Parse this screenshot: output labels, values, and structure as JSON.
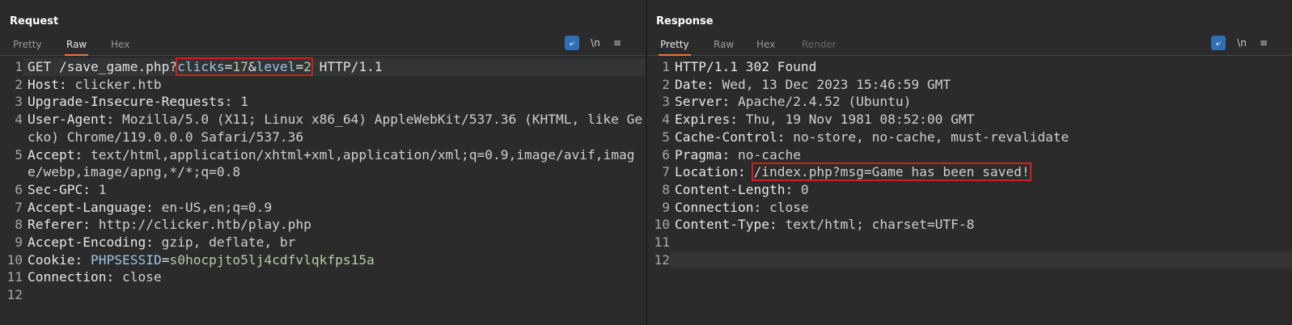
{
  "request": {
    "title": "Request",
    "tabs": [
      {
        "label": "Pretty",
        "active": false
      },
      {
        "label": "Raw",
        "active": true
      },
      {
        "label": "Hex",
        "active": false
      }
    ],
    "newline_toggle": "\\n",
    "menu_icon": "hamburger-icon",
    "lines": {
      "l1_method": "GET /save_game.php?",
      "l1_p1": "clicks",
      "l1_eq1": "=",
      "l1_v1": "17",
      "l1_amp": "&",
      "l1_p2": "level",
      "l1_eq2": "=",
      "l1_v2": "2",
      "l1_proto": " HTTP/1.1",
      "l2_name": "Host:",
      "l2_val": " clicker.htb",
      "l3_name": "Upgrade-Insecure-Requests:",
      "l3_val": " 1",
      "l4_name": "User-Agent:",
      "l4_val": " Mozilla/5.0 (X11; Linux x86_64) AppleWebKit/537.36 (KHTML, like Gecko) Chrome/119.0.0.0 Safari/537.36",
      "l5_name": "Accept:",
      "l5_val": " text/html,application/xhtml+xml,application/xml;q=0.9,image/avif,image/webp,image/apng,*/*;q=0.8",
      "l6_name": "Sec-GPC:",
      "l6_val": " 1",
      "l7_name": "Accept-Language:",
      "l7_val": " en-US,en;q=0.9",
      "l8_name": "Referer:",
      "l8_val": " http://clicker.htb/play.php",
      "l9_name": "Accept-Encoding:",
      "l9_val": " gzip, deflate, br",
      "l10_name": "Cookie:",
      "l10_cname": " PHPSESSID",
      "l10_eq": "=",
      "l10_cval": "s0hocpjto5lj4cdfvlqkfps15a",
      "l11_name": "Connection:",
      "l11_val": " close"
    }
  },
  "response": {
    "title": "Response",
    "tabs": [
      {
        "label": "Pretty",
        "active": true
      },
      {
        "label": "Raw",
        "active": false
      },
      {
        "label": "Hex",
        "active": false
      },
      {
        "label": "Render",
        "active": false
      }
    ],
    "newline_toggle": "\\n",
    "lines": {
      "l1": "HTTP/1.1 302 Found",
      "l2_name": "Date:",
      "l2_val": " Wed, 13 Dec 2023 15:46:59 GMT",
      "l3_name": "Server:",
      "l3_val": " Apache/2.4.52 (Ubuntu)",
      "l4_name": "Expires:",
      "l4_val": " Thu, 19 Nov 1981 08:52:00 GMT",
      "l5_name": "Cache-Control:",
      "l5_val": " no-store, no-cache, must-revalidate",
      "l6_name": "Pragma:",
      "l6_val": " no-cache",
      "l7_name": "Location:",
      "l7_val": "/index.php?msg=Game has been saved!",
      "l8_name": "Content-Length:",
      "l8_val": " 0",
      "l9_name": "Connection:",
      "l9_val": " close",
      "l10_name": "Content-Type:",
      "l10_val": " text/html; charset=UTF-8"
    }
  },
  "line_numbers": [
    "1",
    "2",
    "3",
    "4",
    "5",
    "6",
    "7",
    "8",
    "9",
    "10",
    "11",
    "12"
  ],
  "colors": {
    "accent": "#e8783a",
    "highlight_box": "#d11f1f",
    "toggle_blue": "#2f6fb3"
  }
}
